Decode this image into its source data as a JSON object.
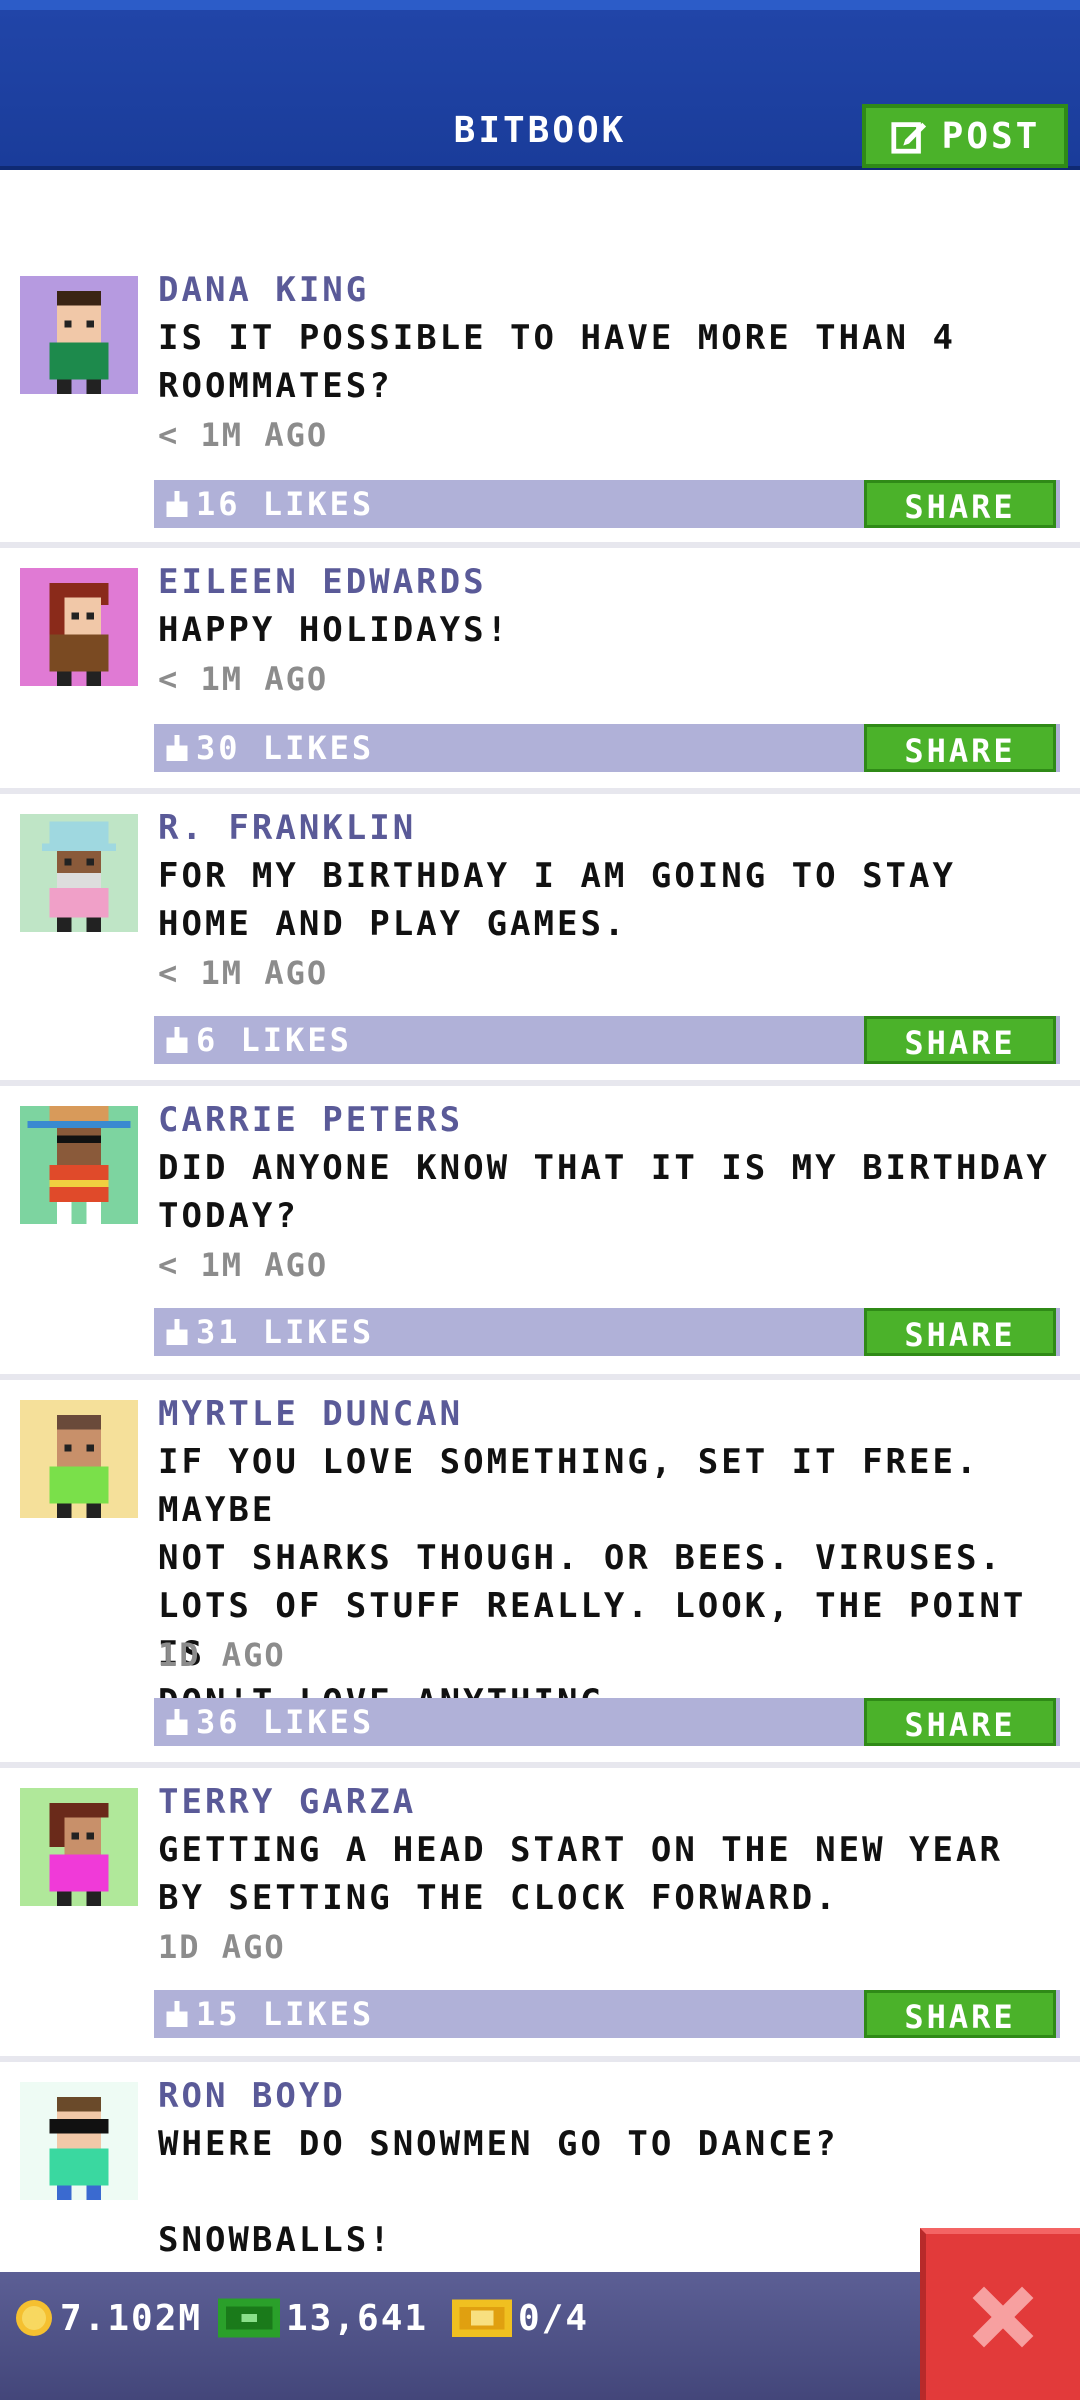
{
  "header": {
    "title": "BITBOOK",
    "post_label": "POST"
  },
  "posts": [
    {
      "author": "DANA KING",
      "text": "IS IT POSSIBLE TO HAVE MORE THAN 4\nROOMMATES?",
      "time": "< 1M AGO",
      "likes": "16 LIKES",
      "share": "SHARE",
      "avatar_bg": "#b69ae0"
    },
    {
      "author": "EILEEN EDWARDS",
      "text": "HAPPY HOLIDAYS!",
      "time": "< 1M AGO",
      "likes": "30 LIKES",
      "share": "SHARE",
      "avatar_bg": "#e07ad4"
    },
    {
      "author": "R. FRANKLIN",
      "text": "FOR MY BIRTHDAY I AM GOING TO STAY\nHOME AND PLAY GAMES.",
      "time": "< 1M AGO",
      "likes": "6 LIKES",
      "share": "SHARE",
      "avatar_bg": "#bfe5c6"
    },
    {
      "author": "CARRIE PETERS",
      "text": "DID ANYONE KNOW THAT IT IS MY BIRTHDAY\nTODAY?",
      "time": "< 1M AGO",
      "likes": "31 LIKES",
      "share": "SHARE",
      "avatar_bg": "#7dd4a0"
    },
    {
      "author": "MYRTLE DUNCAN",
      "text": "IF YOU LOVE SOMETHING, SET IT FREE. MAYBE\nNOT SHARKS THOUGH. OR BEES. VIRUSES.\nLOTS OF STUFF REALLY. LOOK, THE POINT IS\nDON'T LOVE ANYTHING.",
      "time": "1D AGO",
      "likes": "36 LIKES",
      "share": "SHARE",
      "avatar_bg": "#f5e09a"
    },
    {
      "author": "TERRY GARZA",
      "text": "GETTING A HEAD START ON THE NEW YEAR\nBY SETTING THE CLOCK FORWARD.",
      "time": "1D AGO",
      "likes": "15 LIKES",
      "share": "SHARE",
      "avatar_bg": "#b0e89a"
    },
    {
      "author": "RON BOYD",
      "text": "WHERE DO SNOWMEN GO TO DANCE?\n\nSNOWBALLS!",
      "time": "",
      "likes": "",
      "share": "",
      "avatar_bg": "#eefbf4"
    }
  ],
  "footer": {
    "coins": "7.102M",
    "bux": "13,641",
    "tickets": "0/4"
  },
  "colors": {
    "header_blue": "#1a3c9a",
    "green": "#4bb22a",
    "like_bar": "#b0b1d8",
    "author": "#5a5a98",
    "close_red": "#e23a3a"
  },
  "icons": {
    "post": "compose-icon",
    "like": "thumb-icon",
    "coin": "coin-icon",
    "bux": "cash-icon",
    "ticket": "ticket-icon",
    "close": "close-icon"
  }
}
